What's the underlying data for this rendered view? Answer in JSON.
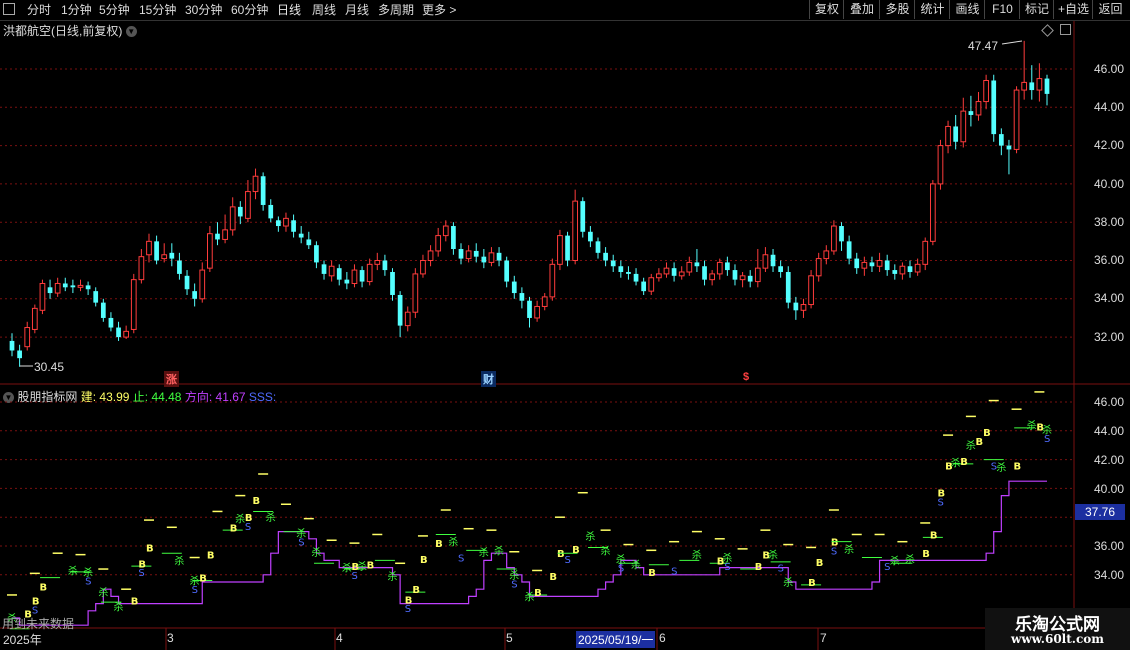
{
  "toolbar": {
    "periods": [
      "分时",
      "1分钟",
      "5分钟",
      "15分钟",
      "30分钟",
      "60分钟",
      "日线",
      "周线",
      "月线",
      "多周期",
      "更多 >"
    ],
    "right_buttons": [
      "复权",
      "叠加",
      "多股",
      "统计",
      "画线",
      "F10",
      "标记",
      "+自选",
      "返回"
    ]
  },
  "main_panel": {
    "title": "洪都航空(日线,前复权)",
    "high_marker": "47.47",
    "low_marker": "30.45",
    "y_axis": [
      "46.00",
      "44.00",
      "42.00",
      "40.00",
      "38.00",
      "36.00",
      "34.00",
      "32.00"
    ],
    "badges": {
      "zhang": "涨",
      "cai": "财",
      "s": "$"
    }
  },
  "indicator_panel": {
    "name": "股朋指标网",
    "jian_label": "建:",
    "jian_value": "43.99",
    "zhi_label": "止:",
    "zhi_value": "44.48",
    "fangxiang_label": "方向:",
    "fangxiang_value": "41.67",
    "sss_label": "SSS:",
    "y_axis": [
      "46.00",
      "44.00",
      "42.00",
      "40.00",
      "38.00",
      "36.00",
      "34.00"
    ],
    "current_value": "37.76",
    "future_data_label": "用到未来数据"
  },
  "x_axis": {
    "year": "2025年",
    "months": [
      "3",
      "4",
      "5",
      "6",
      "7"
    ],
    "cursor_date": "2025/05/19/一"
  },
  "watermark": {
    "line1": "乐淘公式网",
    "line2": "www.60lt.com"
  },
  "colors": {
    "up": "#ff3c3c",
    "down": "#54ffff",
    "grid": "#7a1010",
    "direction": "#c040ff",
    "sss": "#4f6bff",
    "build": "#ffff66",
    "stop": "#40ff40"
  },
  "chart_data": {
    "type": "candlestick",
    "ylim": [
      30.5,
      47.5
    ],
    "candles": [
      [
        31.8,
        31.3,
        32.2,
        31.0
      ],
      [
        31.3,
        30.9,
        31.6,
        30.45
      ],
      [
        31.5,
        32.5,
        32.8,
        31.3
      ],
      [
        32.4,
        33.5,
        33.7,
        32.2
      ],
      [
        33.4,
        34.8,
        35.0,
        33.2
      ],
      [
        34.6,
        34.3,
        35.0,
        34.0
      ],
      [
        34.3,
        34.8,
        35.1,
        34.1
      ],
      [
        34.8,
        34.6,
        35.1,
        34.4
      ],
      [
        34.7,
        34.6,
        35.0,
        34.3
      ],
      [
        34.6,
        34.7,
        35.0,
        34.4
      ],
      [
        34.7,
        34.5,
        34.9,
        34.2
      ],
      [
        34.4,
        33.8,
        34.6,
        33.6
      ],
      [
        33.8,
        33.0,
        34.0,
        32.8
      ],
      [
        33.0,
        32.5,
        33.3,
        32.3
      ],
      [
        32.5,
        32.0,
        32.8,
        31.8
      ],
      [
        32.0,
        32.3,
        32.6,
        31.9
      ],
      [
        32.4,
        35.0,
        35.3,
        32.2
      ],
      [
        35.0,
        36.2,
        36.6,
        34.8
      ],
      [
        36.3,
        37.0,
        37.4,
        35.9
      ],
      [
        37.0,
        36.0,
        37.3,
        35.8
      ],
      [
        36.1,
        36.3,
        36.9,
        35.9
      ],
      [
        36.4,
        36.1,
        36.9,
        35.7
      ],
      [
        36.0,
        35.3,
        36.4,
        35.0
      ],
      [
        35.2,
        34.5,
        35.5,
        34.2
      ],
      [
        34.4,
        34.0,
        34.8,
        33.6
      ],
      [
        34.0,
        35.5,
        35.9,
        33.8
      ],
      [
        35.6,
        37.4,
        37.8,
        35.4
      ],
      [
        37.4,
        37.1,
        38.0,
        36.8
      ],
      [
        37.1,
        37.6,
        38.4,
        36.9
      ],
      [
        37.6,
        38.8,
        39.3,
        37.3
      ],
      [
        38.8,
        38.3,
        39.1,
        37.9
      ],
      [
        38.2,
        39.6,
        40.2,
        38.0
      ],
      [
        39.6,
        40.4,
        40.8,
        39.2
      ],
      [
        40.4,
        38.9,
        40.6,
        38.6
      ],
      [
        38.9,
        38.2,
        39.2,
        38.0
      ],
      [
        38.1,
        37.8,
        38.3,
        37.5
      ],
      [
        37.8,
        38.2,
        38.5,
        37.5
      ],
      [
        38.1,
        37.5,
        38.4,
        37.2
      ],
      [
        37.4,
        37.2,
        37.8,
        36.9
      ],
      [
        37.1,
        36.8,
        37.5,
        36.6
      ],
      [
        36.8,
        35.9,
        37.0,
        35.6
      ],
      [
        35.8,
        35.3,
        36.0,
        35.0
      ],
      [
        35.2,
        35.7,
        36.0,
        34.9
      ],
      [
        35.6,
        35.0,
        35.8,
        34.7
      ],
      [
        35.0,
        34.8,
        35.4,
        34.5
      ],
      [
        34.8,
        35.5,
        35.8,
        34.6
      ],
      [
        35.5,
        34.9,
        35.7,
        34.6
      ],
      [
        34.9,
        35.8,
        36.1,
        34.7
      ],
      [
        35.8,
        36.0,
        36.4,
        35.5
      ],
      [
        36.0,
        35.5,
        36.3,
        35.2
      ],
      [
        35.4,
        34.2,
        35.6,
        33.9
      ],
      [
        34.2,
        32.6,
        34.4,
        32.0
      ],
      [
        32.6,
        33.3,
        33.6,
        32.3
      ],
      [
        33.3,
        35.3,
        35.6,
        33.0
      ],
      [
        35.3,
        36.0,
        36.3,
        35.1
      ],
      [
        36.0,
        36.5,
        36.8,
        35.7
      ],
      [
        36.5,
        37.3,
        37.7,
        36.2
      ],
      [
        37.3,
        37.8,
        38.1,
        37.0
      ],
      [
        37.8,
        36.6,
        38.0,
        36.3
      ],
      [
        36.6,
        36.1,
        36.9,
        35.8
      ],
      [
        36.1,
        36.5,
        36.8,
        35.9
      ],
      [
        36.5,
        36.2,
        36.9,
        35.9
      ],
      [
        36.2,
        35.9,
        36.6,
        35.6
      ],
      [
        35.9,
        36.4,
        36.7,
        35.7
      ],
      [
        36.4,
        36.0,
        36.7,
        35.7
      ],
      [
        36.0,
        34.9,
        36.2,
        34.6
      ],
      [
        34.9,
        34.3,
        35.2,
        34.0
      ],
      [
        34.3,
        33.9,
        34.6,
        33.5
      ],
      [
        33.9,
        33.0,
        34.1,
        32.5
      ],
      [
        33.0,
        33.6,
        33.9,
        32.8
      ],
      [
        33.6,
        34.1,
        34.3,
        33.4
      ],
      [
        34.1,
        35.8,
        36.1,
        33.9
      ],
      [
        35.8,
        37.3,
        37.6,
        35.5
      ],
      [
        37.3,
        36.0,
        37.5,
        35.7
      ],
      [
        36.0,
        39.1,
        39.7,
        35.8
      ],
      [
        39.1,
        37.5,
        39.3,
        37.2
      ],
      [
        37.5,
        37.0,
        37.8,
        36.7
      ],
      [
        37.0,
        36.4,
        37.2,
        36.1
      ],
      [
        36.4,
        36.0,
        36.7,
        35.7
      ],
      [
        36.0,
        35.7,
        36.3,
        35.4
      ],
      [
        35.7,
        35.4,
        36.0,
        35.1
      ],
      [
        35.4,
        35.3,
        35.7,
        35.0
      ],
      [
        35.3,
        34.9,
        35.6,
        34.7
      ],
      [
        34.9,
        34.4,
        35.1,
        34.2
      ],
      [
        34.4,
        35.1,
        35.3,
        34.2
      ],
      [
        35.1,
        35.3,
        35.6,
        34.9
      ],
      [
        35.3,
        35.6,
        35.9,
        35.1
      ],
      [
        35.6,
        35.2,
        35.9,
        34.9
      ],
      [
        35.2,
        35.4,
        35.7,
        35.0
      ],
      [
        35.4,
        35.9,
        36.2,
        35.2
      ],
      [
        35.9,
        35.7,
        36.6,
        35.4
      ],
      [
        35.7,
        35.0,
        36.0,
        34.7
      ],
      [
        35.0,
        35.3,
        35.5,
        34.7
      ],
      [
        35.3,
        35.9,
        36.1,
        35.0
      ],
      [
        35.9,
        35.5,
        36.2,
        35.2
      ],
      [
        35.5,
        35.0,
        35.8,
        34.7
      ],
      [
        35.0,
        35.2,
        35.4,
        34.6
      ],
      [
        35.2,
        34.9,
        35.5,
        34.6
      ],
      [
        34.9,
        35.6,
        36.6,
        34.6
      ],
      [
        35.6,
        36.3,
        36.7,
        35.4
      ],
      [
        36.3,
        35.7,
        36.6,
        35.4
      ],
      [
        35.7,
        35.4,
        36.0,
        35.1
      ],
      [
        35.4,
        33.8,
        35.7,
        33.5
      ],
      [
        33.8,
        33.4,
        34.1,
        32.9
      ],
      [
        33.4,
        33.7,
        34.0,
        33.0
      ],
      [
        33.7,
        35.2,
        35.5,
        33.5
      ],
      [
        35.2,
        36.1,
        36.4,
        34.9
      ],
      [
        36.1,
        36.5,
        36.8,
        35.8
      ],
      [
        36.5,
        37.8,
        38.1,
        36.3
      ],
      [
        37.8,
        37.0,
        38.0,
        36.5
      ],
      [
        37.0,
        36.1,
        37.3,
        35.8
      ],
      [
        36.1,
        35.6,
        36.4,
        35.3
      ],
      [
        35.6,
        35.9,
        36.2,
        35.2
      ],
      [
        35.9,
        35.7,
        36.2,
        35.4
      ],
      [
        35.7,
        36.0,
        36.4,
        35.4
      ],
      [
        36.0,
        35.5,
        36.3,
        35.2
      ],
      [
        35.5,
        35.3,
        35.8,
        35.0
      ],
      [
        35.3,
        35.7,
        35.9,
        35.0
      ],
      [
        35.7,
        35.4,
        36.0,
        35.1
      ],
      [
        35.4,
        35.8,
        36.1,
        35.2
      ],
      [
        35.8,
        37.0,
        37.2,
        35.5
      ],
      [
        37.0,
        40.0,
        40.2,
        36.8
      ],
      [
        40.0,
        42.0,
        42.3,
        39.7
      ],
      [
        42.0,
        43.0,
        43.3,
        41.6
      ],
      [
        43.0,
        42.2,
        43.6,
        41.8
      ],
      [
        42.2,
        43.8,
        44.5,
        41.9
      ],
      [
        43.8,
        43.6,
        44.6,
        43.0
      ],
      [
        43.6,
        44.3,
        44.8,
        43.3
      ],
      [
        44.3,
        45.4,
        45.7,
        43.9
      ],
      [
        45.4,
        42.6,
        45.7,
        42.2
      ],
      [
        42.6,
        42.0,
        42.9,
        41.5
      ],
      [
        42.0,
        41.8,
        42.3,
        40.5
      ],
      [
        41.8,
        44.9,
        45.1,
        41.6
      ],
      [
        44.9,
        45.3,
        47.47,
        44.4
      ],
      [
        45.3,
        44.9,
        46.2,
        44.4
      ],
      [
        44.9,
        45.5,
        46.3,
        44.3
      ],
      [
        45.5,
        44.7,
        45.7,
        44.1
      ]
    ]
  }
}
